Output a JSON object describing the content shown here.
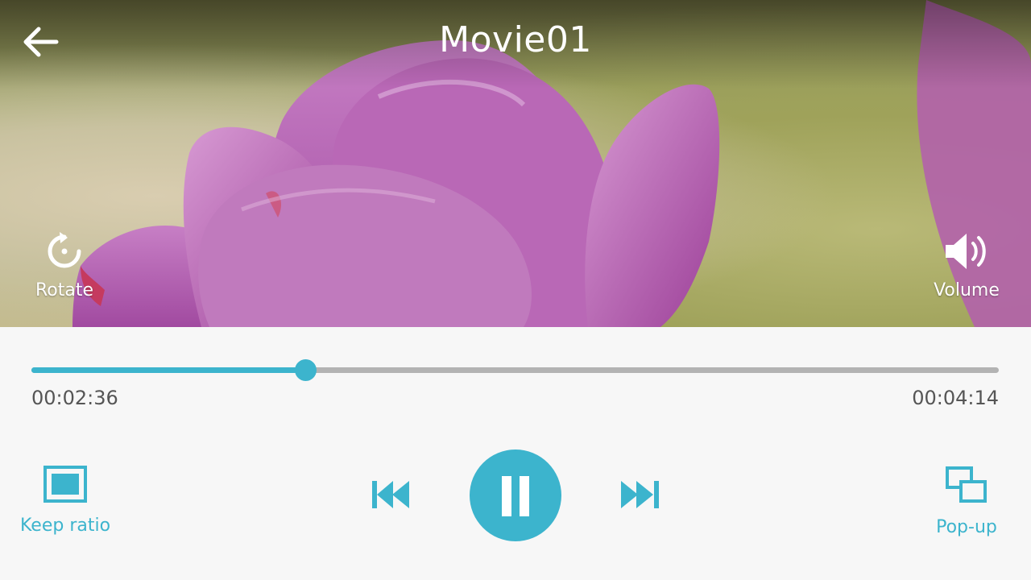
{
  "header": {
    "title": "Movie01",
    "back_icon": "arrow-left-icon"
  },
  "overlay": {
    "rotate_label": "Rotate",
    "rotate_icon": "rotate-icon",
    "volume_label": "Volume",
    "volume_icon": "speaker-icon"
  },
  "progress": {
    "current_time": "00:02:36",
    "total_time": "00:04:14",
    "fraction": 0.283
  },
  "controls": {
    "keep_ratio_label": "Keep ratio",
    "popup_label": "Pop-up",
    "icons": [
      "aspect-ratio-icon",
      "previous-track-icon",
      "pause-icon",
      "next-track-icon",
      "popup-window-icon"
    ]
  },
  "colors": {
    "accent": "#3cb4cd",
    "track": "#b3b3b3",
    "panel_bg": "#f7f7f7",
    "time_text": "#555555"
  }
}
